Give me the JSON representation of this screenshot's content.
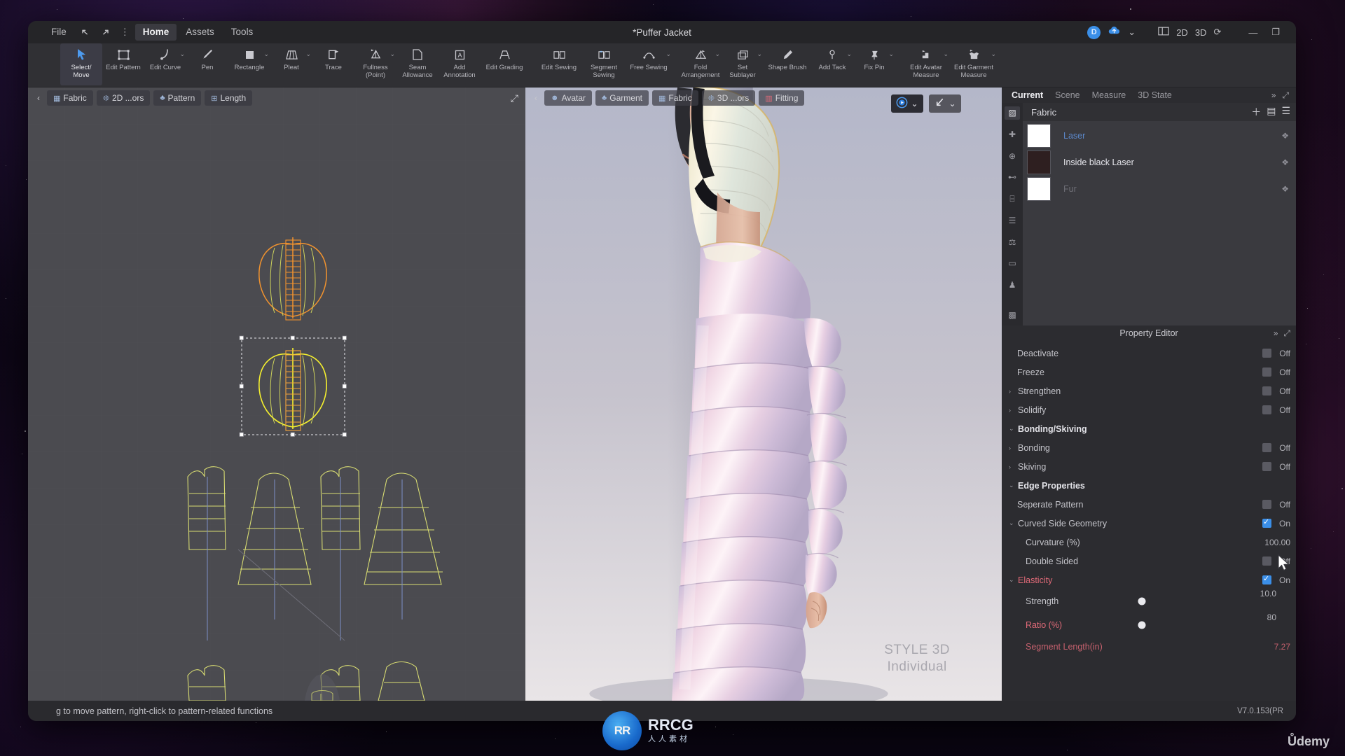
{
  "window": {
    "title": "*Puffer Jacket",
    "menus": [
      "File",
      "Home",
      "Assets",
      "Tools"
    ],
    "undo_icon": "undo-icon",
    "redo_icon": "redo-icon",
    "more_icon": "more-vertical-icon",
    "account_initial": "D",
    "upload_icon": "cloud-upload-icon",
    "layout_icon": "layout-split-icon",
    "view_2d": "2D",
    "view_3d": "3D",
    "sync_icon": "refresh-icon",
    "minimize": "—",
    "restore": "❐"
  },
  "ribbon": {
    "tools": [
      {
        "label": "Select/\nMove",
        "icon": "cursor-arrow-icon",
        "caret": false,
        "active": true
      },
      {
        "label": "Edit Pattern",
        "icon": "rectangle-node-icon",
        "caret": false,
        "active": false
      },
      {
        "label": "Edit Curve",
        "icon": "curve-icon",
        "caret": true,
        "active": false
      },
      {
        "label": "Pen",
        "icon": "pen-icon",
        "caret": false,
        "active": false
      },
      {
        "label": "Rectangle",
        "icon": "square-icon",
        "caret": true,
        "active": false
      },
      {
        "label": "Pleat",
        "icon": "pleat-skirt-icon",
        "caret": true,
        "active": false
      },
      {
        "label": "Trace",
        "icon": "trace-icon",
        "caret": false,
        "active": false
      },
      {
        "label": "Fullness\n(Point)",
        "icon": "fullness-icon",
        "caret": true,
        "active": false
      },
      {
        "label": "Seam\nAllowance",
        "icon": "seam-allowance-icon",
        "caret": false,
        "active": false
      },
      {
        "label": "Add\nAnnotation",
        "icon": "annotation-a-icon",
        "caret": false,
        "active": false
      },
      {
        "label": "Edit Grading",
        "icon": "grading-icon",
        "caret": false,
        "active": false
      },
      {
        "label": "Edit Sewing",
        "icon": "edit-sewing-icon",
        "caret": false,
        "active": false
      },
      {
        "label": "Segment\nSewing",
        "icon": "segment-sewing-icon",
        "caret": false,
        "active": false
      },
      {
        "label": "Free Sewing",
        "icon": "free-sewing-icon",
        "caret": true,
        "active": false
      },
      {
        "label": "Fold\nArrangement",
        "icon": "fold-arrangement-icon",
        "caret": true,
        "active": false
      },
      {
        "label": "Set\nSublayer",
        "icon": "set-sublayer-icon",
        "caret": true,
        "active": false
      },
      {
        "label": "Shape Brush",
        "icon": "shape-brush-icon",
        "caret": false,
        "active": false
      },
      {
        "label": "Add Tack",
        "icon": "add-tack-icon",
        "caret": true,
        "active": false
      },
      {
        "label": "Fix Pin",
        "icon": "fix-pin-icon",
        "caret": true,
        "active": false
      },
      {
        "label": "Edit Avatar\nMeasure",
        "icon": "avatar-measure-icon",
        "caret": true,
        "active": false
      },
      {
        "label": "Edit Garment\nMeasure",
        "icon": "garment-measure-icon",
        "caret": true,
        "active": false
      }
    ]
  },
  "pane2d": {
    "back_icon": "chevron-left-icon",
    "tabs": [
      {
        "label": "Fabric",
        "icon": "fabric-icon"
      },
      {
        "label": "2D ...ors",
        "icon": "colorways-icon"
      },
      {
        "label": "Pattern",
        "icon": "pattern-icon"
      },
      {
        "label": "Length",
        "icon": "length-icon"
      }
    ],
    "expand_icon": "expand-arrows-icon"
  },
  "pane3d": {
    "back_icon": "chevron-left-icon",
    "tabs": [
      {
        "label": "Avatar",
        "icon": "avatar-icon"
      },
      {
        "label": "Garment",
        "icon": "garment-icon"
      },
      {
        "label": "Fabric",
        "icon": "fabric-icon"
      },
      {
        "label": "3D ...ors",
        "icon": "colorways-icon"
      },
      {
        "label": "Fitting",
        "icon": "fitting-icon"
      }
    ],
    "buttons": [
      {
        "icon": "simulate-icon",
        "caret": true,
        "active": true
      },
      {
        "icon": "gravity-arrow-icon",
        "caret": true,
        "active": false
      }
    ],
    "watermark_line1": "STYLE 3D",
    "watermark_line2": "Individual"
  },
  "inspector": {
    "tabs": [
      "Current",
      "Scene",
      "Measure",
      "3D State"
    ],
    "active_tab": "Current",
    "collapse_icon": "chevrons-right-icon",
    "expand_icon": "expand-arrows-icon",
    "fabric": {
      "title": "Fabric",
      "add_icon": "plus-icon",
      "grid_icon": "grid-list-icon",
      "list_icon": "list-icon",
      "rail_icons": [
        "fabric-swatch-icon",
        "puzzle-icon",
        "button-icon",
        "zipper-icon",
        "mannequin-icon",
        "divider-icon",
        "topstitch-icon",
        "trim-icon",
        "texture-icon"
      ],
      "items": [
        {
          "name": "Laser",
          "color": "#ffffff",
          "selected": true
        },
        {
          "name": "Inside black Laser",
          "color": "#2e1f20",
          "selected": false
        },
        {
          "name": "Fur",
          "color": "#ffffff",
          "selected": false
        }
      ]
    },
    "property_editor": {
      "title": "Property Editor",
      "rows": [
        {
          "kind": "toggle",
          "label": "Deactivate",
          "indent": 1,
          "arrow": "",
          "value": "Off",
          "on": false
        },
        {
          "kind": "toggle",
          "label": "Freeze",
          "indent": 1,
          "arrow": "",
          "value": "Off",
          "on": false
        },
        {
          "kind": "toggle",
          "label": "Strengthen",
          "indent": 0,
          "arrow": "›",
          "value": "Off",
          "on": false
        },
        {
          "kind": "toggle",
          "label": "Solidify",
          "indent": 0,
          "arrow": "›",
          "value": "Off",
          "on": false
        },
        {
          "kind": "group",
          "label": "Bonding/Skiving",
          "indent": 0,
          "arrow": "⌄",
          "value": "",
          "on": false
        },
        {
          "kind": "toggle",
          "label": "Bonding",
          "indent": 0,
          "arrow": "›",
          "value": "Off",
          "on": false
        },
        {
          "kind": "toggle",
          "label": "Skiving",
          "indent": 0,
          "arrow": "›",
          "value": "Off",
          "on": false
        },
        {
          "kind": "group",
          "label": "Edge Properties",
          "indent": 0,
          "arrow": "⌄",
          "value": "",
          "on": false
        },
        {
          "kind": "toggle",
          "label": "Seperate Pattern",
          "indent": 1,
          "arrow": "",
          "value": "Off",
          "on": false
        },
        {
          "kind": "toggle",
          "label": "Curved Side Geometry",
          "indent": 0,
          "arrow": "⌄",
          "value": "On",
          "on": true
        },
        {
          "kind": "number",
          "label": "Curvature (%)",
          "indent": 2,
          "arrow": "",
          "value": "100.00",
          "on": false
        },
        {
          "kind": "toggle",
          "label": "Double Sided",
          "indent": 2,
          "arrow": "",
          "value": "Off",
          "on": false
        },
        {
          "kind": "toggle",
          "label": "Elasticity",
          "indent": 0,
          "arrow": "⌄",
          "value": "On",
          "on": true,
          "red": true
        }
      ],
      "sliders": [
        {
          "label": "Strength",
          "value": "10.0",
          "pos": 16,
          "red": false
        },
        {
          "label": "Ratio (%)",
          "value": "80",
          "pos": 40,
          "red": true
        }
      ],
      "last_row": {
        "label": "Segment Length(in)",
        "value": "7.27",
        "red": true
      }
    }
  },
  "statusbar": {
    "message": "g to move pattern, right-click to pattern-related functions",
    "version": "V7.0.153(PR"
  },
  "overlay": {
    "rrcg_title": "RRCG",
    "rrcg_sub": "人人素材",
    "rrcg_badge": "RR",
    "udemy": "Ůdemy"
  },
  "colors": {
    "accent_blue": "#3b8fe8",
    "link_blue": "#5b87c9",
    "red_label": "#e06a78",
    "panel_bg": "#2c2c30",
    "ribbon_bg": "#303034"
  }
}
